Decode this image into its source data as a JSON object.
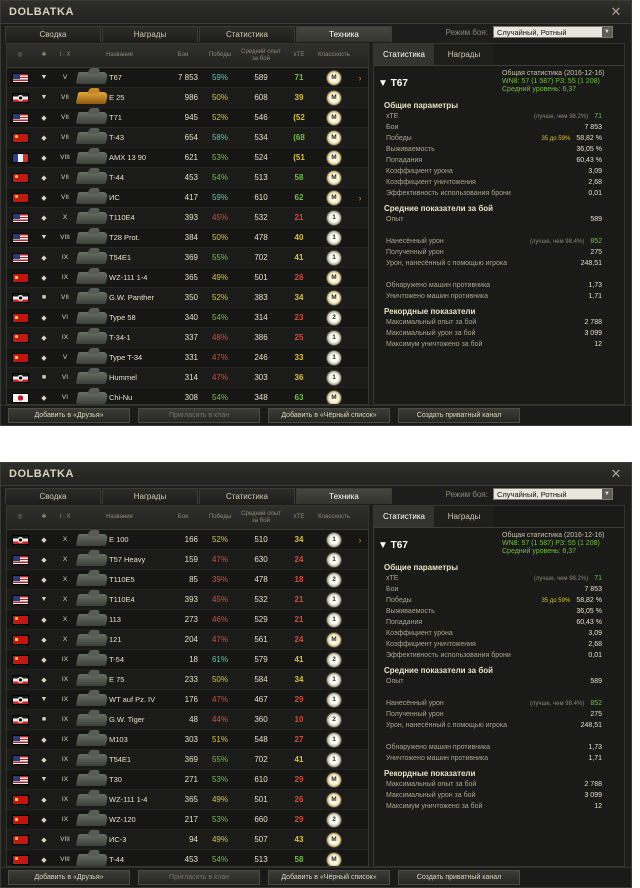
{
  "window_title": "DOLBATKA",
  "close_glyph": "✕",
  "tabs": [
    "Сводка",
    "Награды",
    "Статистика",
    "Техника"
  ],
  "active_tab": 3,
  "mode_label": "Режим боя:",
  "mode_value": "Случайный, Ротный",
  "columns": [
    "I - X",
    "Название",
    "Бои",
    "Победы",
    "Средний опыт за бой",
    "xTE",
    "Классность"
  ],
  "side_tabs": [
    "Статистика",
    "Награды"
  ],
  "summary": {
    "name": "T67",
    "line1": "Общая статистика (2016-12-16)",
    "line2_prefix": "WN8: 57 (1 587) РЗ: 55 (1 208)",
    "line3": "Средний уровень: 6,37"
  },
  "sections": [
    {
      "title": "Общие параметры",
      "rows": [
        {
          "k": "xTE",
          "mid": "(лучше, чем 98.2%)",
          "v": "71",
          "green": true
        },
        {
          "k": "Бои",
          "v": "7 853"
        },
        {
          "k": "Победы",
          "midy": "35 до 59%",
          "v": "58,82 %"
        },
        {
          "k": "Выживаемость",
          "v": "36,05 %"
        },
        {
          "k": "Попадания",
          "v": "60,43 %"
        },
        {
          "k": "Коэффициент урона",
          "v": "3,09"
        },
        {
          "k": "Коэффициент уничтожения",
          "v": "2,68"
        },
        {
          "k": "Эффективность использования брони",
          "v": "0,01"
        }
      ]
    },
    {
      "title": "Средние показатели за бой",
      "rows": [
        {
          "k": "Опыт",
          "v": "589"
        },
        {
          "k": "",
          "v": ""
        },
        {
          "k": "Нанесённый урон",
          "mid": "(лучше, чем 98.4%)",
          "v": "852",
          "green": true
        },
        {
          "k": "Полученный урон",
          "v": "275"
        },
        {
          "k": "Урон, нанесённый с помощью игрока",
          "v": "248,51"
        },
        {
          "k": "",
          "v": ""
        },
        {
          "k": "Обнаружено машин противника",
          "v": "1,73"
        },
        {
          "k": "Уничтожено машин противника",
          "v": "1,71"
        }
      ]
    },
    {
      "title": "Рекордные показатели",
      "rows": [
        {
          "k": "Максимальный опыт за бой",
          "v": "2 788"
        },
        {
          "k": "Максимальный урон за бой",
          "v": "3 099"
        },
        {
          "k": "Максимум уничтожено за бой",
          "v": "12"
        }
      ]
    }
  ],
  "buttons": [
    "Добавить в «Друзья»",
    "Пригласить в клан",
    "Добавить в «Чёрный список»",
    "Создать приватный канал"
  ],
  "table1": [
    {
      "flag": "usa",
      "type": "▼",
      "tier": "V",
      "name": "T67",
      "b": "7 853",
      "w": "59%",
      "wc": "tq",
      "e": "589",
      "x": "71",
      "xc": "gr",
      "m": "M",
      "sel": true
    },
    {
      "flag": "ger",
      "type": "▼",
      "tier": "VII",
      "name": "E 25",
      "b": "986",
      "w": "50%",
      "wc": "ye",
      "e": "608",
      "x": "39",
      "xc": "ye",
      "m": "M",
      "gold": true
    },
    {
      "flag": "usa",
      "type": "◆",
      "tier": "VII",
      "name": "T71",
      "b": "945",
      "w": "52%",
      "wc": "ye",
      "e": "546",
      "x": "(52",
      "xc": "ye",
      "m": "M"
    },
    {
      "flag": "ussr",
      "type": "◆",
      "tier": "VII",
      "name": "T-43",
      "b": "654",
      "w": "58%",
      "wc": "tq",
      "e": "534",
      "x": "(68",
      "xc": "gr",
      "m": "M"
    },
    {
      "flag": "fra",
      "type": "◆",
      "tier": "VIII",
      "name": "AMX 13 90",
      "b": "621",
      "w": "53%",
      "wc": "gr",
      "e": "524",
      "x": "(51",
      "xc": "ye",
      "m": "M"
    },
    {
      "flag": "ussr",
      "type": "◆",
      "tier": "VII",
      "name": "T-44",
      "b": "453",
      "w": "54%",
      "wc": "gr",
      "e": "513",
      "x": "58",
      "xc": "gr",
      "m": "M"
    },
    {
      "flag": "ussr",
      "type": "◆",
      "tier": "VII",
      "name": "ИС",
      "b": "417",
      "w": "59%",
      "wc": "tq",
      "e": "610",
      "x": "62",
      "xc": "gr",
      "m": "M",
      "sel": true
    },
    {
      "flag": "usa",
      "type": "◆",
      "tier": "X",
      "name": "T110E4",
      "b": "393",
      "w": "45%",
      "wc": "rd",
      "e": "532",
      "x": "21",
      "xc": "rd",
      "m": "1"
    },
    {
      "flag": "usa",
      "type": "▼",
      "tier": "VIII",
      "name": "T28 Prot.",
      "b": "384",
      "w": "50%",
      "wc": "ye",
      "e": "478",
      "x": "40",
      "xc": "ye",
      "m": "1"
    },
    {
      "flag": "usa",
      "type": "◆",
      "tier": "IX",
      "name": "T54E1",
      "b": "369",
      "w": "55%",
      "wc": "gr",
      "e": "702",
      "x": "41",
      "xc": "ye",
      "m": "1"
    },
    {
      "flag": "chn",
      "type": "◆",
      "tier": "IX",
      "name": "WZ-111 1-4",
      "b": "365",
      "w": "49%",
      "wc": "ye",
      "e": "501",
      "x": "26",
      "xc": "rd",
      "m": "M"
    },
    {
      "flag": "ger",
      "type": "■",
      "tier": "VII",
      "name": "G.W. Panther",
      "b": "350",
      "w": "52%",
      "wc": "ye",
      "e": "383",
      "x": "34",
      "xc": "ye",
      "m": "M"
    },
    {
      "flag": "chn",
      "type": "◆",
      "tier": "VI",
      "name": "Type 58",
      "b": "340",
      "w": "54%",
      "wc": "gr",
      "e": "314",
      "x": "23",
      "xc": "rd",
      "m": "2"
    },
    {
      "flag": "ussr",
      "type": "◆",
      "tier": "IX",
      "name": "T-34-1",
      "b": "337",
      "w": "48%",
      "wc": "rd",
      "e": "386",
      "x": "25",
      "xc": "rd",
      "m": "1"
    },
    {
      "flag": "chn",
      "type": "◆",
      "tier": "V",
      "name": "Type T-34",
      "b": "331",
      "w": "47%",
      "wc": "rd",
      "e": "246",
      "x": "33",
      "xc": "ye",
      "m": "1"
    },
    {
      "flag": "ger",
      "type": "■",
      "tier": "VI",
      "name": "Hummel",
      "b": "314",
      "w": "47%",
      "wc": "rd",
      "e": "303",
      "x": "36",
      "xc": "ye",
      "m": "1"
    },
    {
      "flag": "jpn",
      "type": "◆",
      "tier": "VI",
      "name": "Chi-Nu",
      "b": "308",
      "w": "54%",
      "wc": "gr",
      "e": "348",
      "x": "63",
      "xc": "gr",
      "m": "M"
    }
  ],
  "table2": [
    {
      "flag": "ger",
      "type": "◆",
      "tier": "X",
      "name": "E 100",
      "b": "166",
      "w": "52%",
      "wc": "ye",
      "e": "510",
      "x": "34",
      "xc": "ye",
      "m": "1",
      "sel": true
    },
    {
      "flag": "usa",
      "type": "◆",
      "tier": "X",
      "name": "T57 Heavy",
      "b": "159",
      "w": "47%",
      "wc": "rd",
      "e": "630",
      "x": "24",
      "xc": "rd",
      "m": "1"
    },
    {
      "flag": "usa",
      "type": "◆",
      "tier": "X",
      "name": "T110E5",
      "b": "85",
      "w": "39%",
      "wc": "rd",
      "e": "478",
      "x": "18",
      "xc": "rd",
      "m": "2"
    },
    {
      "flag": "usa",
      "type": "▼",
      "tier": "X",
      "name": "T110E4",
      "b": "393",
      "w": "45%",
      "wc": "rd",
      "e": "532",
      "x": "21",
      "xc": "rd",
      "m": "1"
    },
    {
      "flag": "ussr",
      "type": "◆",
      "tier": "X",
      "name": "113",
      "b": "273",
      "w": "46%",
      "wc": "rd",
      "e": "529",
      "x": "21",
      "xc": "rd",
      "m": "1"
    },
    {
      "flag": "chn",
      "type": "◆",
      "tier": "X",
      "name": "121",
      "b": "204",
      "w": "47%",
      "wc": "rd",
      "e": "561",
      "x": "24",
      "xc": "rd",
      "m": "M"
    },
    {
      "flag": "ussr",
      "type": "◆",
      "tier": "IX",
      "name": "T-54",
      "b": "18",
      "w": "61%",
      "wc": "tq",
      "e": "579",
      "x": "41",
      "xc": "ye",
      "m": "2"
    },
    {
      "flag": "ger",
      "type": "◆",
      "tier": "IX",
      "name": "E 75",
      "b": "233",
      "w": "50%",
      "wc": "ye",
      "e": "584",
      "x": "34",
      "xc": "ye",
      "m": "1"
    },
    {
      "flag": "ger",
      "type": "▼",
      "tier": "IX",
      "name": "WT auf Pz. IV",
      "b": "176",
      "w": "47%",
      "wc": "rd",
      "e": "467",
      "x": "29",
      "xc": "rd",
      "m": "1"
    },
    {
      "flag": "ger",
      "type": "■",
      "tier": "IX",
      "name": "G.W. Tiger",
      "b": "48",
      "w": "44%",
      "wc": "rd",
      "e": "360",
      "x": "10",
      "xc": "rd",
      "m": "2"
    },
    {
      "flag": "usa",
      "type": "◆",
      "tier": "IX",
      "name": "M103",
      "b": "303",
      "w": "51%",
      "wc": "ye",
      "e": "548",
      "x": "27",
      "xc": "rd",
      "m": "1"
    },
    {
      "flag": "usa",
      "type": "◆",
      "tier": "IX",
      "name": "T54E1",
      "b": "369",
      "w": "55%",
      "wc": "gr",
      "e": "702",
      "x": "41",
      "xc": "ye",
      "m": "1"
    },
    {
      "flag": "usa",
      "type": "▼",
      "tier": "IX",
      "name": "T30",
      "b": "271",
      "w": "53%",
      "wc": "gr",
      "e": "610",
      "x": "29",
      "xc": "rd",
      "m": "M"
    },
    {
      "flag": "chn",
      "type": "◆",
      "tier": "IX",
      "name": "WZ-111 1-4",
      "b": "365",
      "w": "49%",
      "wc": "ye",
      "e": "501",
      "x": "26",
      "xc": "rd",
      "m": "M"
    },
    {
      "flag": "chn",
      "type": "◆",
      "tier": "IX",
      "name": "WZ-120",
      "b": "217",
      "w": "53%",
      "wc": "gr",
      "e": "660",
      "x": "29",
      "xc": "rd",
      "m": "2"
    },
    {
      "flag": "ussr",
      "type": "◆",
      "tier": "VIII",
      "name": "ИС-3",
      "b": "94",
      "w": "49%",
      "wc": "ye",
      "e": "507",
      "x": "43",
      "xc": "ye",
      "m": "M"
    },
    {
      "flag": "ussr",
      "type": "◆",
      "tier": "VIII",
      "name": "T-44",
      "b": "453",
      "w": "54%",
      "wc": "gr",
      "e": "513",
      "x": "58",
      "xc": "gr",
      "m": "M"
    }
  ]
}
